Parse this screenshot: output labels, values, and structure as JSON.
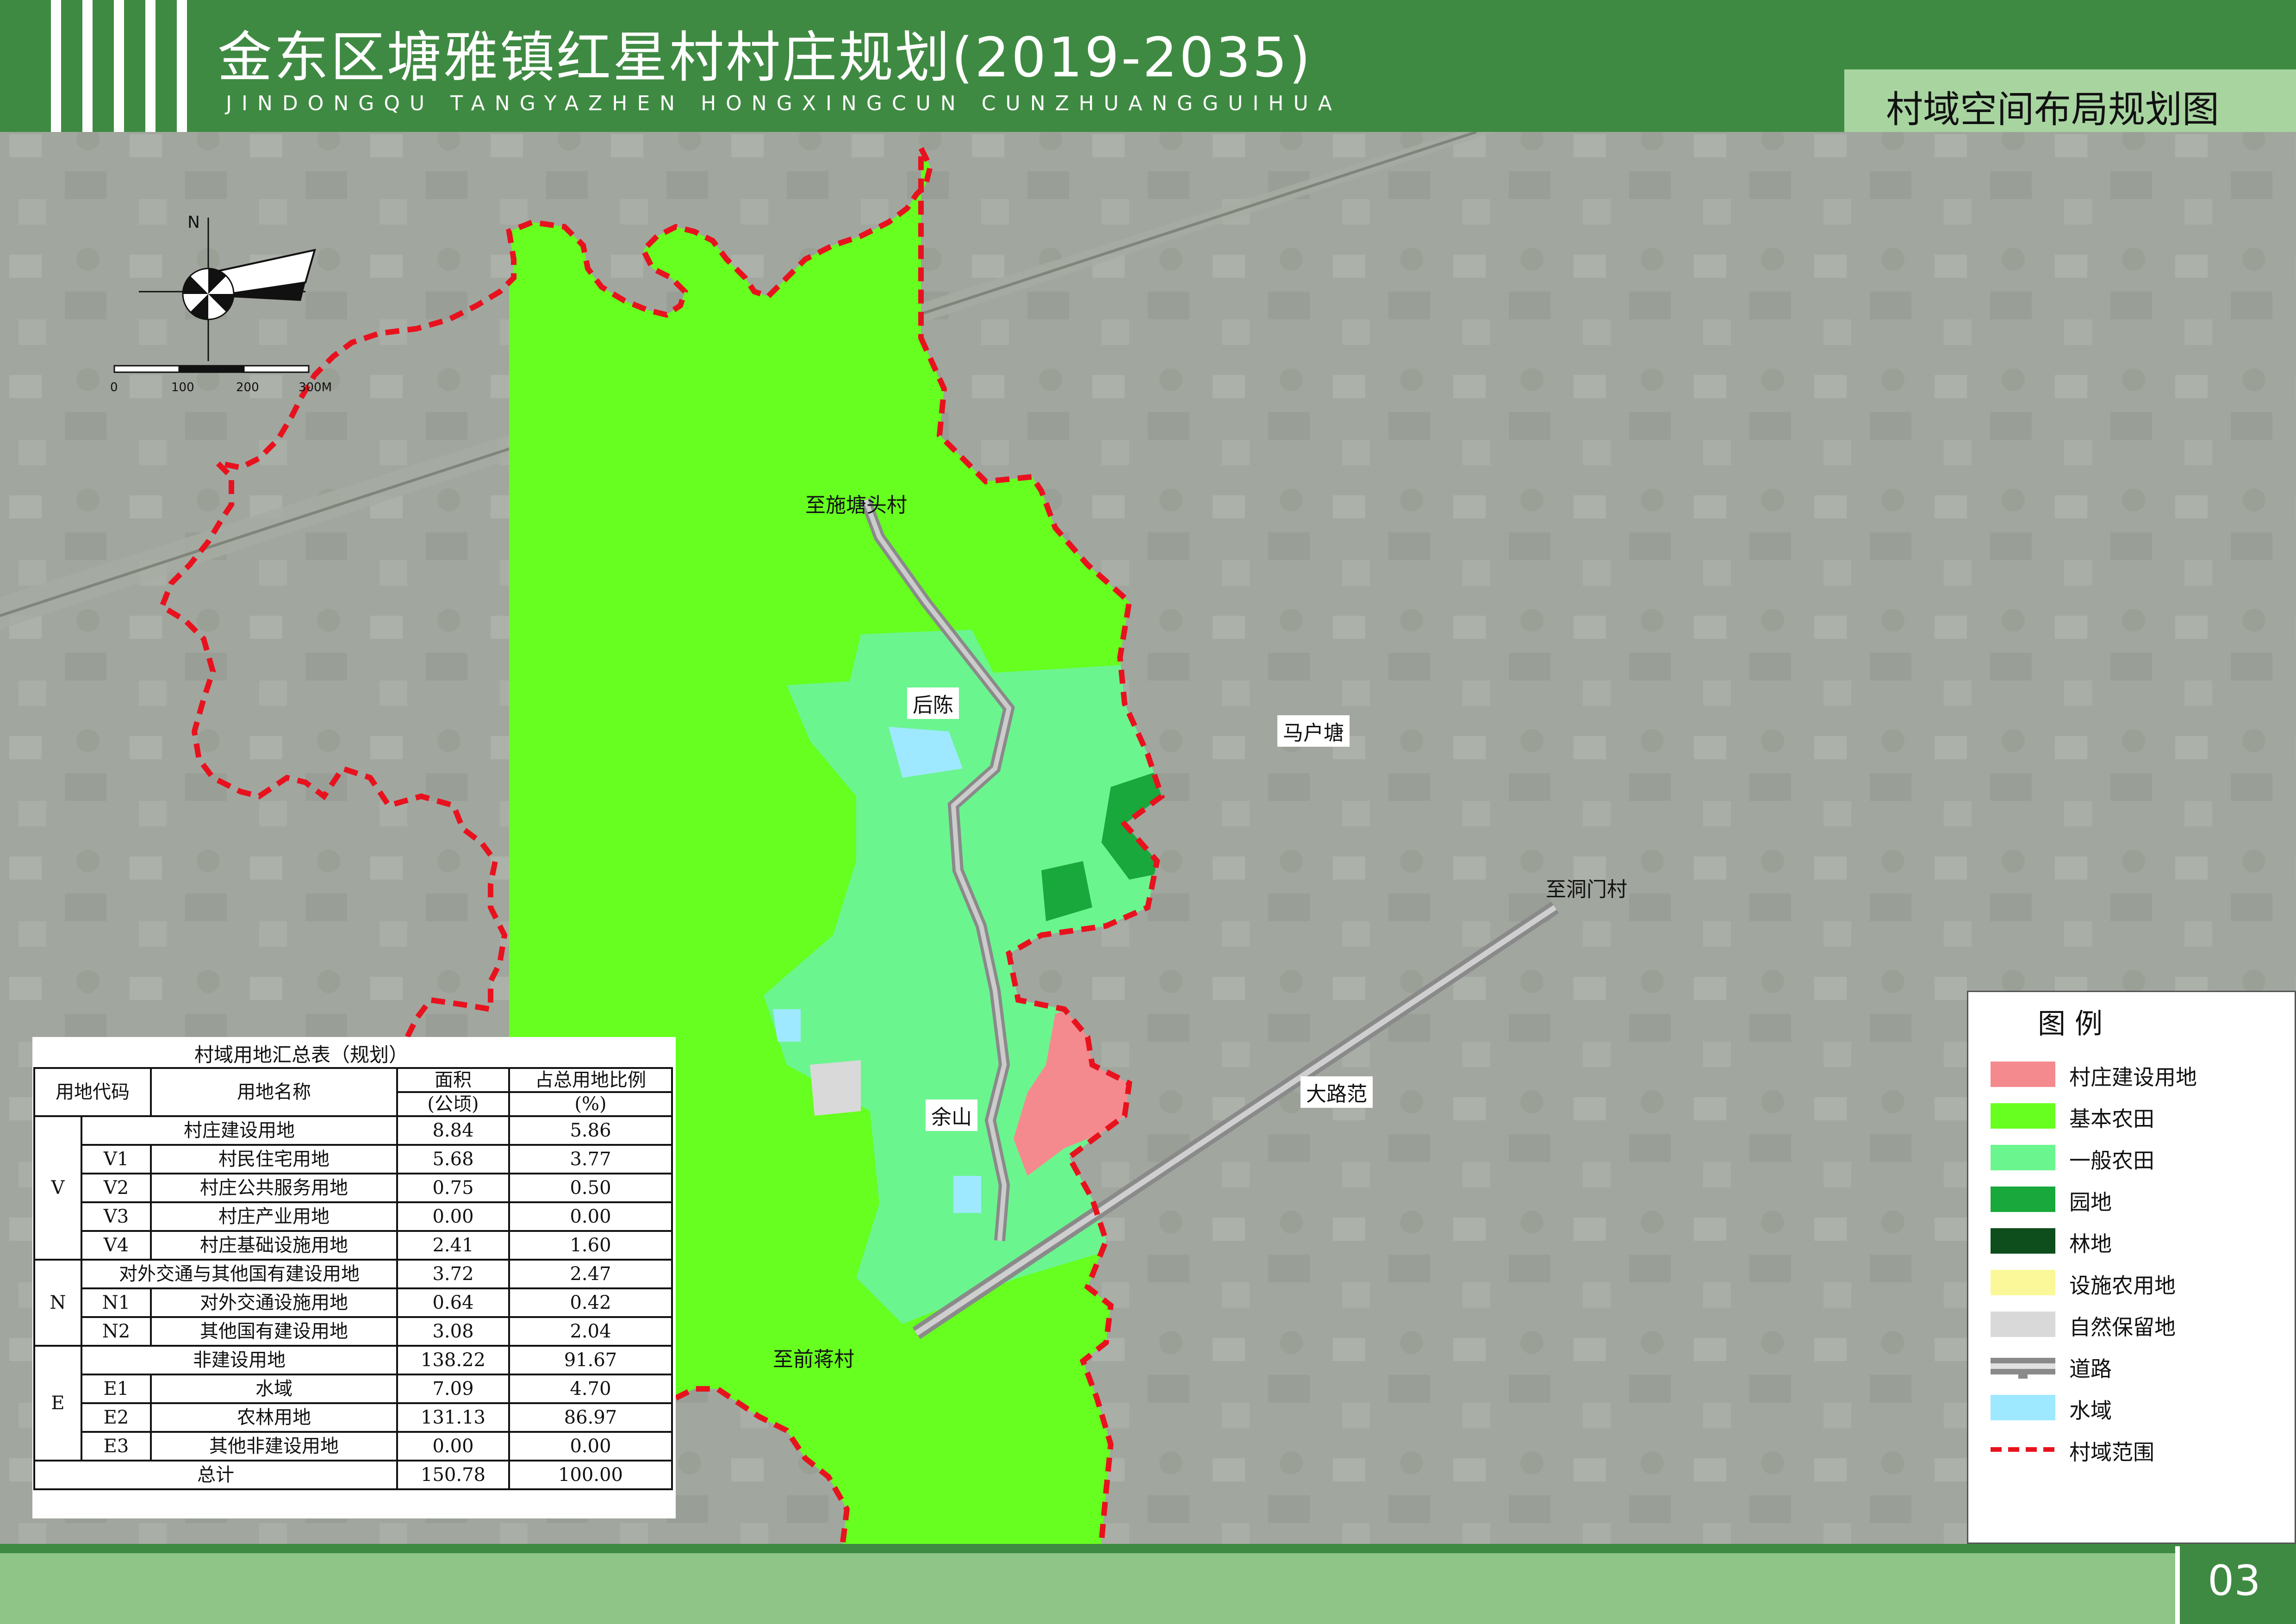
{
  "header": {
    "title": "金东区塘雅镇红星村村庄规划(2019-2035)",
    "subtitle": "JINDONGQU TANGYAZHEN HONGXINGCUN CUNZHUANGGUIHUA",
    "map_title": "村域空间布局规划图"
  },
  "colors": {
    "header_green": "#3f8a42",
    "village_construction": "#f48a8e",
    "basic_farmland": "#66ff1f",
    "general_farmland": "#6bf58f",
    "garden": "#19a83c",
    "forest": "#0e4d1c",
    "facility_farmland": "#fbf89a",
    "natural_reserve": "#d9d9d9",
    "water": "#9ee9ff",
    "boundary": "#e8121e"
  },
  "map": {
    "compass_north": "N",
    "scale_labels": [
      "0",
      "100",
      "200",
      "300M"
    ],
    "places": [
      "后陈",
      "马户塘",
      "余山",
      "大路范"
    ],
    "road_labels": [
      "至施塘头村",
      "至洞门村",
      "至前蒋村"
    ]
  },
  "legend": {
    "title": "图例",
    "items": [
      {
        "label": "村庄建设用地",
        "icon": "fill-swatch"
      },
      {
        "label": "基本农田",
        "icon": "fill-swatch"
      },
      {
        "label": "一般农田",
        "icon": "fill-swatch"
      },
      {
        "label": "园地",
        "icon": "fill-swatch"
      },
      {
        "label": "林地",
        "icon": "fill-swatch"
      },
      {
        "label": "设施农用地",
        "icon": "fill-swatch"
      },
      {
        "label": "自然保留地",
        "icon": "fill-swatch"
      },
      {
        "label": "道路",
        "icon": "road-symbol"
      },
      {
        "label": "水域",
        "icon": "fill-swatch"
      },
      {
        "label": "村域范围",
        "icon": "dashed-line"
      }
    ]
  },
  "table": {
    "caption": "村域用地汇总表（规划）",
    "headers": {
      "code": "用地代码",
      "name": "用地名称",
      "area": "面积",
      "area_unit": "(公顷)",
      "ratio": "占总用地比例",
      "ratio_unit": "(%)"
    },
    "rows": [
      {
        "group": "V",
        "code": "",
        "name": "村庄建设用地",
        "area": "8.84",
        "ratio": "5.86"
      },
      {
        "group": "V",
        "code": "V1",
        "name": "村民住宅用地",
        "area": "5.68",
        "ratio": "3.77"
      },
      {
        "group": "V",
        "code": "V2",
        "name": "村庄公共服务用地",
        "area": "0.75",
        "ratio": "0.50"
      },
      {
        "group": "V",
        "code": "V3",
        "name": "村庄产业用地",
        "area": "0.00",
        "ratio": "0.00"
      },
      {
        "group": "V",
        "code": "V4",
        "name": "村庄基础设施用地",
        "area": "2.41",
        "ratio": "1.60"
      },
      {
        "group": "N",
        "code": "",
        "name": "对外交通与其他国有建设用地",
        "area": "3.72",
        "ratio": "2.47"
      },
      {
        "group": "N",
        "code": "N1",
        "name": "对外交通设施用地",
        "area": "0.64",
        "ratio": "0.42"
      },
      {
        "group": "N",
        "code": "N2",
        "name": "其他国有建设用地",
        "area": "3.08",
        "ratio": "2.04"
      },
      {
        "group": "E",
        "code": "",
        "name": "非建设用地",
        "area": "138.22",
        "ratio": "91.67"
      },
      {
        "group": "E",
        "code": "E1",
        "name": "水域",
        "area": "7.09",
        "ratio": "4.70"
      },
      {
        "group": "E",
        "code": "E2",
        "name": "农林用地",
        "area": "131.13",
        "ratio": "86.97"
      },
      {
        "group": "E",
        "code": "E3",
        "name": "其他非建设用地",
        "area": "0.00",
        "ratio": "0.00"
      }
    ],
    "total": {
      "label": "总计",
      "area": "150.78",
      "ratio": "100.00"
    }
  },
  "footer": {
    "page_number": "03"
  }
}
